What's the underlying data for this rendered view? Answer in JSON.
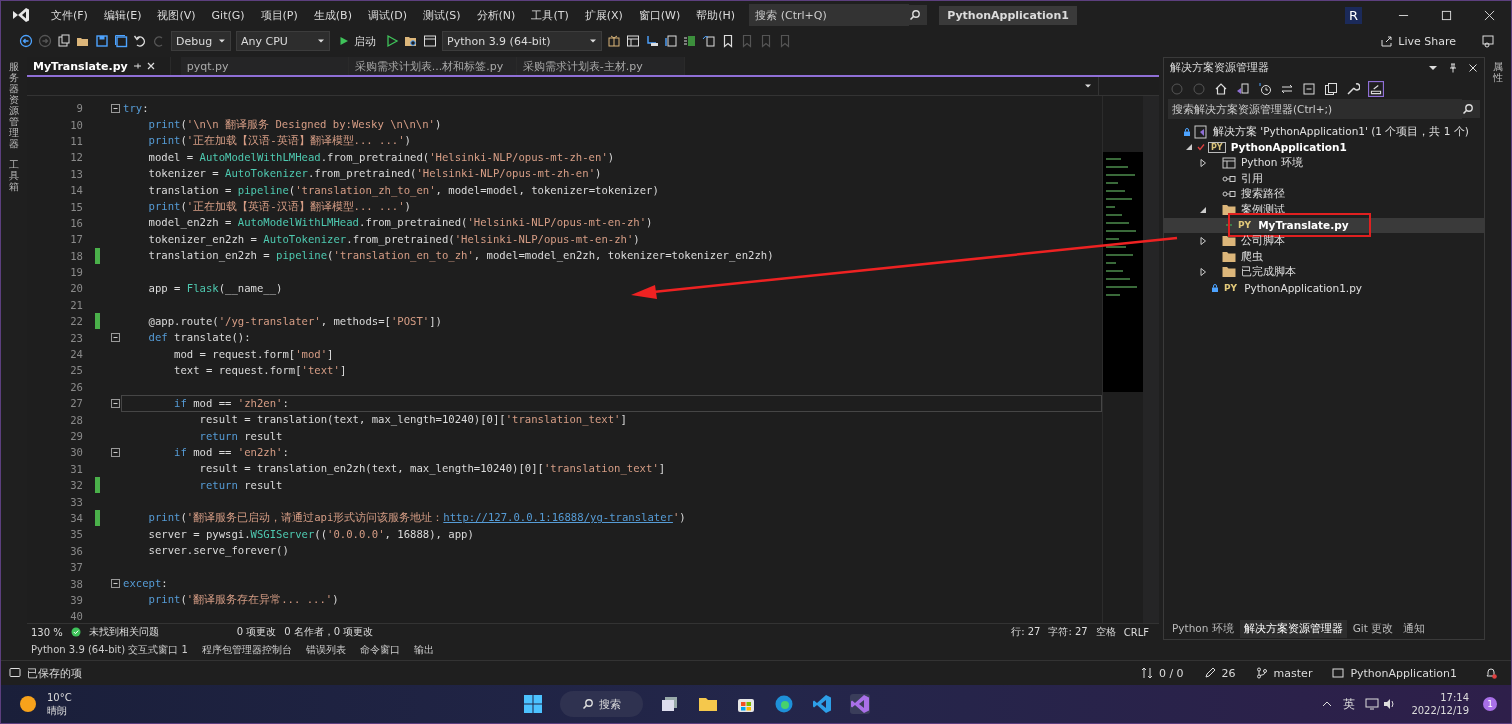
{
  "menu": {
    "items": [
      "文件(F)",
      "编辑(E)",
      "视图(V)",
      "Git(G)",
      "项目(P)",
      "生成(B)",
      "调试(D)",
      "测试(S)",
      "分析(N)",
      "工具(T)",
      "扩展(X)",
      "窗口(W)",
      "帮助(H)"
    ]
  },
  "search": {
    "placeholder": "搜索 (Ctrl+Q)"
  },
  "window": {
    "title": "PythonApplication1",
    "account": "R"
  },
  "toolbar": {
    "configuration": "Debug",
    "platform": "Any CPU",
    "start": "启动",
    "environment": "Python 3.9 (64-bit)",
    "live_share": "Live Share"
  },
  "tabs": [
    {
      "label": "MyTranslate.py",
      "selected": true
    },
    {
      "label": "pyqt.py",
      "selected": false
    },
    {
      "label": "采购需求计划表...材和标签.py",
      "selected": false
    },
    {
      "label": "采购需求计划表-主材.py",
      "selected": false
    }
  ],
  "side_strip": {
    "left": [
      "服务器资源管理器",
      "工具箱"
    ],
    "right": [
      "属性"
    ]
  },
  "code": {
    "lines": [
      {
        "number": "9",
        "fold": true,
        "modified": false,
        "current": false,
        "tokens": [
          {
            "kind": "keyword",
            "text": "try"
          },
          {
            "kind": "plain",
            "text": ":"
          }
        ]
      },
      {
        "number": "10",
        "fold": false,
        "modified": false,
        "current": false,
        "tokens": [
          {
            "kind": "keyword",
            "text": "    print"
          },
          {
            "kind": "plain",
            "text": "("
          },
          {
            "kind": "string",
            "text": "'\\n\\n 翻译服务 Designed by:Wesky \\n\\n\\n'"
          },
          {
            "kind": "plain",
            "text": ")"
          }
        ]
      },
      {
        "number": "11",
        "fold": false,
        "modified": false,
        "current": false,
        "tokens": [
          {
            "kind": "keyword",
            "text": "    print"
          },
          {
            "kind": "plain",
            "text": "("
          },
          {
            "kind": "string",
            "text": "'正在加载【汉语-英语】翻译模型... ...'"
          },
          {
            "kind": "plain",
            "text": ")"
          }
        ]
      },
      {
        "number": "12",
        "fold": false,
        "modified": false,
        "current": false,
        "tokens": [
          {
            "kind": "plain",
            "text": "    model = "
          },
          {
            "kind": "type",
            "text": "AutoModelWithLMHead"
          },
          {
            "kind": "plain",
            "text": ".from_pretrained("
          },
          {
            "kind": "string",
            "text": "'Helsinki-NLP/opus-mt-zh-en'"
          },
          {
            "kind": "plain",
            "text": ")"
          }
        ]
      },
      {
        "number": "13",
        "fold": false,
        "modified": false,
        "current": false,
        "tokens": [
          {
            "kind": "plain",
            "text": "    tokenizer = "
          },
          {
            "kind": "type",
            "text": "AutoTokenizer"
          },
          {
            "kind": "plain",
            "text": ".from_pretrained("
          },
          {
            "kind": "string",
            "text": "'Helsinki-NLP/opus-mt-zh-en'"
          },
          {
            "kind": "plain",
            "text": ")"
          }
        ]
      },
      {
        "number": "14",
        "fold": false,
        "modified": false,
        "current": false,
        "tokens": [
          {
            "kind": "plain",
            "text": "    translation = "
          },
          {
            "kind": "type",
            "text": "pipeline"
          },
          {
            "kind": "plain",
            "text": "("
          },
          {
            "kind": "string",
            "text": "'translation_zh_to_en'"
          },
          {
            "kind": "plain",
            "text": ", model=model, tokenizer=tokenizer)"
          }
        ]
      },
      {
        "number": "15",
        "fold": false,
        "modified": false,
        "current": false,
        "tokens": [
          {
            "kind": "keyword",
            "text": "    print"
          },
          {
            "kind": "plain",
            "text": "("
          },
          {
            "kind": "string",
            "text": "'正在加载【英语-汉语】翻译模型... ...'"
          },
          {
            "kind": "plain",
            "text": ")"
          }
        ]
      },
      {
        "number": "16",
        "fold": false,
        "modified": false,
        "current": false,
        "tokens": [
          {
            "kind": "plain",
            "text": "    model_en2zh = "
          },
          {
            "kind": "type",
            "text": "AutoModelWithLMHead"
          },
          {
            "kind": "plain",
            "text": ".from_pretrained("
          },
          {
            "kind": "string",
            "text": "'Helsinki-NLP/opus-mt-en-zh'"
          },
          {
            "kind": "plain",
            "text": ")"
          }
        ]
      },
      {
        "number": "17",
        "fold": false,
        "modified": false,
        "current": false,
        "tokens": [
          {
            "kind": "plain",
            "text": "    tokenizer_en2zh = "
          },
          {
            "kind": "type",
            "text": "AutoTokenizer"
          },
          {
            "kind": "plain",
            "text": ".from_pretrained("
          },
          {
            "kind": "string",
            "text": "'Helsinki-NLP/opus-mt-en-zh'"
          },
          {
            "kind": "plain",
            "text": ")"
          }
        ]
      },
      {
        "number": "18",
        "fold": false,
        "modified": true,
        "current": false,
        "tokens": [
          {
            "kind": "plain",
            "text": "    translation_en2zh = "
          },
          {
            "kind": "type",
            "text": "pipeline"
          },
          {
            "kind": "plain",
            "text": "("
          },
          {
            "kind": "string",
            "text": "'translation_en_to_zh'"
          },
          {
            "kind": "plain",
            "text": ", model=model_en2zh, tokenizer=tokenizer_en2zh)"
          }
        ]
      },
      {
        "number": "19",
        "fold": false,
        "modified": false,
        "current": false
      },
      {
        "number": "20",
        "fold": false,
        "modified": false,
        "current": false,
        "tokens": [
          {
            "kind": "plain",
            "text": "    app = "
          },
          {
            "kind": "type",
            "text": "Flask"
          },
          {
            "kind": "plain",
            "text": "(__name__)"
          }
        ]
      },
      {
        "number": "21",
        "fold": false,
        "modified": false,
        "current": false
      },
      {
        "number": "22",
        "fold": false,
        "modified": true,
        "current": false,
        "tokens": [
          {
            "kind": "plain",
            "text": "    @app.route("
          },
          {
            "kind": "string",
            "text": "'/yg-translater'"
          },
          {
            "kind": "plain",
            "text": ", methods=["
          },
          {
            "kind": "string",
            "text": "'POST'"
          },
          {
            "kind": "plain",
            "text": "])"
          }
        ]
      },
      {
        "number": "23",
        "fold": true,
        "modified": false,
        "current": false,
        "tokens": [
          {
            "kind": "keyword",
            "text": "    def"
          },
          {
            "kind": "plain",
            "text": " translate():"
          }
        ]
      },
      {
        "number": "24",
        "fold": false,
        "modified": false,
        "current": false,
        "tokens": [
          {
            "kind": "plain",
            "text": "        mod = request.form["
          },
          {
            "kind": "string",
            "text": "'mod'"
          },
          {
            "kind": "plain",
            "text": "]"
          }
        ]
      },
      {
        "number": "25",
        "fold": false,
        "modified": false,
        "current": false,
        "tokens": [
          {
            "kind": "plain",
            "text": "        text = request.form["
          },
          {
            "kind": "string",
            "text": "'text'"
          },
          {
            "kind": "plain",
            "text": "]"
          }
        ]
      },
      {
        "number": "26",
        "fold": false,
        "modified": false,
        "current": false
      },
      {
        "number": "27",
        "fold": true,
        "modified": false,
        "current": true,
        "tokens": [
          {
            "kind": "keyword",
            "text": "        if"
          },
          {
            "kind": "plain",
            "text": " mod == "
          },
          {
            "kind": "string",
            "text": "'zh2en'"
          },
          {
            "kind": "plain",
            "text": ":"
          }
        ]
      },
      {
        "number": "28",
        "fold": false,
        "modified": false,
        "current": false,
        "tokens": [
          {
            "kind": "plain",
            "text": "            result = translation(text, max_length=10240)[0]["
          },
          {
            "kind": "string",
            "text": "'translation_text'"
          },
          {
            "kind": "plain",
            "text": "]"
          }
        ]
      },
      {
        "number": "29",
        "fold": false,
        "modified": false,
        "current": false,
        "tokens": [
          {
            "kind": "keyword",
            "text": "            return"
          },
          {
            "kind": "plain",
            "text": " result"
          }
        ]
      },
      {
        "number": "30",
        "fold": true,
        "modified": false,
        "current": false,
        "tokens": [
          {
            "kind": "keyword",
            "text": "        if"
          },
          {
            "kind": "plain",
            "text": " mod == "
          },
          {
            "kind": "string",
            "text": "'en2zh'"
          },
          {
            "kind": "plain",
            "text": ":"
          }
        ]
      },
      {
        "number": "31",
        "fold": false,
        "modified": false,
        "current": false,
        "tokens": [
          {
            "kind": "plain",
            "text": "            result = translation_en2zh(text, max_length=10240)[0]["
          },
          {
            "kind": "string",
            "text": "'translation_text'"
          },
          {
            "kind": "plain",
            "text": "]"
          }
        ]
      },
      {
        "number": "32",
        "fold": false,
        "modified": true,
        "current": false,
        "tokens": [
          {
            "kind": "keyword",
            "text": "            return"
          },
          {
            "kind": "plain",
            "text": " result"
          }
        ]
      },
      {
        "number": "33",
        "fold": false,
        "modified": false,
        "current": false
      },
      {
        "number": "34",
        "fold": false,
        "modified": true,
        "current": false,
        "tokens": [
          {
            "kind": "keyword",
            "text": "    print"
          },
          {
            "kind": "plain",
            "text": "("
          },
          {
            "kind": "string",
            "text": "'翻译服务已启动，请通过api形式访问该服务地址："
          },
          {
            "kind": "link",
            "text": "http://127.0.0.1:16888/yg-translater"
          },
          {
            "kind": "string",
            "text": "'"
          },
          {
            "kind": "plain",
            "text": ")"
          }
        ]
      },
      {
        "number": "35",
        "fold": false,
        "modified": false,
        "current": false,
        "tokens": [
          {
            "kind": "plain",
            "text": "    server = pywsgi."
          },
          {
            "kind": "type",
            "text": "WSGIServer"
          },
          {
            "kind": "plain",
            "text": "(("
          },
          {
            "kind": "string",
            "text": "'0.0.0.0'"
          },
          {
            "kind": "plain",
            "text": ", 16888), app)"
          }
        ]
      },
      {
        "number": "36",
        "fold": false,
        "modified": false,
        "current": false,
        "tokens": [
          {
            "kind": "plain",
            "text": "    server.serve_forever()"
          }
        ]
      },
      {
        "number": "37",
        "fold": false,
        "modified": false,
        "current": false
      },
      {
        "number": "38",
        "fold": true,
        "modified": false,
        "current": false,
        "tokens": [
          {
            "kind": "keyword",
            "text": "except"
          },
          {
            "kind": "plain",
            "text": ":"
          }
        ]
      },
      {
        "number": "39",
        "fold": false,
        "modified": false,
        "current": false,
        "tokens": [
          {
            "kind": "keyword",
            "text": "    print"
          },
          {
            "kind": "plain",
            "text": "("
          },
          {
            "kind": "string",
            "text": "'翻译服务存在异常... ...'"
          },
          {
            "kind": "plain",
            "text": ")"
          }
        ]
      },
      {
        "number": "40",
        "fold": false,
        "modified": false,
        "current": false
      }
    ]
  },
  "editor_status": {
    "zoom": "130 %",
    "issues": "未找到相关问题",
    "changes": "0 项更改",
    "authors": "0 名作者，0 项更改",
    "line": "行: 27",
    "column": "字符: 27",
    "indent": "空格",
    "line_ending": "CRLF"
  },
  "explorer": {
    "title": "解决方案资源管理器",
    "search": {
      "placeholder": "搜索解决方案资源管理器(Ctrl+;)"
    },
    "tree": [
      {
        "label": "解决方案 'PythonApplication1' (1 个项目，共 1 个)",
        "kind": "solution",
        "locked": true,
        "checked": false,
        "added": false,
        "selected": false,
        "children": [
          {
            "label": "PythonApplication1",
            "kind": "project",
            "icon_text": "PY",
            "locked": false,
            "checked": true,
            "added": false,
            "expanded": true,
            "selected": false,
            "children": [
              {
                "label": "Python 环境",
                "kind": "environment",
                "locked": false,
                "checked": false,
                "added": false,
                "expanded": false,
                "selected": false
              },
              {
                "label": "引用",
                "kind": "reference",
                "locked": false,
                "checked": false,
                "added": false,
                "selected": false
              },
              {
                "label": "搜索路径",
                "kind": "reference",
                "locked": false,
                "checked": false,
                "added": false,
                "selected": false
              },
              {
                "label": "案例测试",
                "kind": "folder",
                "locked": false,
                "checked": false,
                "added": false,
                "expanded": true,
                "selected": false,
                "children": [
                  {
                    "label": "MyTranslate.py",
                    "kind": "file",
                    "icon_text": "PY",
                    "locked": false,
                    "checked": false,
                    "added": true,
                    "selected": true
                  }
                ]
              },
              {
                "label": "公司脚本",
                "kind": "folder",
                "locked": false,
                "checked": false,
                "added": false,
                "expanded": false,
                "selected": false
              },
              {
                "label": "爬虫",
                "kind": "folder",
                "locked": false,
                "checked": false,
                "added": false,
                "selected": false
              },
              {
                "label": "已完成脚本",
                "kind": "folder",
                "locked": false,
                "checked": false,
                "added": false,
                "expanded": false,
                "selected": false
              },
              {
                "label": "PythonApplication1.py",
                "kind": "file",
                "icon_text": "PY",
                "locked": true,
                "checked": false,
                "added": false,
                "selected": false
              }
            ]
          }
        ]
      }
    ],
    "tabs": [
      {
        "label": "Python 环境",
        "selected": false
      },
      {
        "label": "解决方案资源管理器",
        "selected": true
      },
      {
        "label": "Git 更改",
        "selected": false
      },
      {
        "label": "通知",
        "selected": false
      }
    ]
  },
  "tool_windows": [
    "Python 3.9 (64-bit) 交互式窗口 1",
    "程序包管理器控制台",
    "错误列表",
    "命令窗口",
    "输出"
  ],
  "status_bar": {
    "message": "已保存的项",
    "sync": "0 / 0",
    "edits": "26",
    "branch": "master",
    "repo": "PythonApplication1"
  },
  "taskbar": {
    "temperature": "10°C",
    "condition": "晴朗",
    "search": "搜索",
    "ime": "英",
    "time": "17:14",
    "date": "2022/12/19",
    "notifications": "1"
  }
}
